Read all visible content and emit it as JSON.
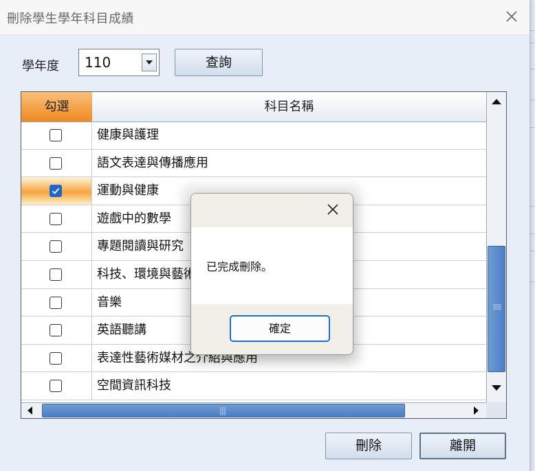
{
  "window": {
    "title": "刪除學生學年科目成績"
  },
  "filter": {
    "year_label": "學年度",
    "year_value": "110",
    "query_label": "查詢"
  },
  "grid": {
    "col_check": "勾選",
    "col_name": "科目名稱",
    "rows": [
      {
        "name": "健康與護理",
        "checked": false
      },
      {
        "name": "語文表達與傳播應用",
        "checked": false
      },
      {
        "name": "運動與健康",
        "checked": true
      },
      {
        "name": "遊戲中的數學",
        "checked": false
      },
      {
        "name": "專題閱讀與研究",
        "checked": false
      },
      {
        "name": "科技、環境與藝術",
        "checked": false
      },
      {
        "name": "音樂",
        "checked": false
      },
      {
        "name": "英語聽講",
        "checked": false
      },
      {
        "name": "表達性藝術媒材之介紹與應用",
        "checked": false
      },
      {
        "name": "空間資訊科技",
        "checked": false
      }
    ]
  },
  "buttons": {
    "delete_label": "刪除",
    "leave_label": "離開"
  },
  "dialog": {
    "message": "已完成刪除。",
    "ok_label": "確定"
  },
  "colors": {
    "header_check": "#f08a1e",
    "checkbox_on": "#1d68c9",
    "scroll_thumb": "#4b7ec4",
    "ok_border": "#1b6fd0"
  }
}
